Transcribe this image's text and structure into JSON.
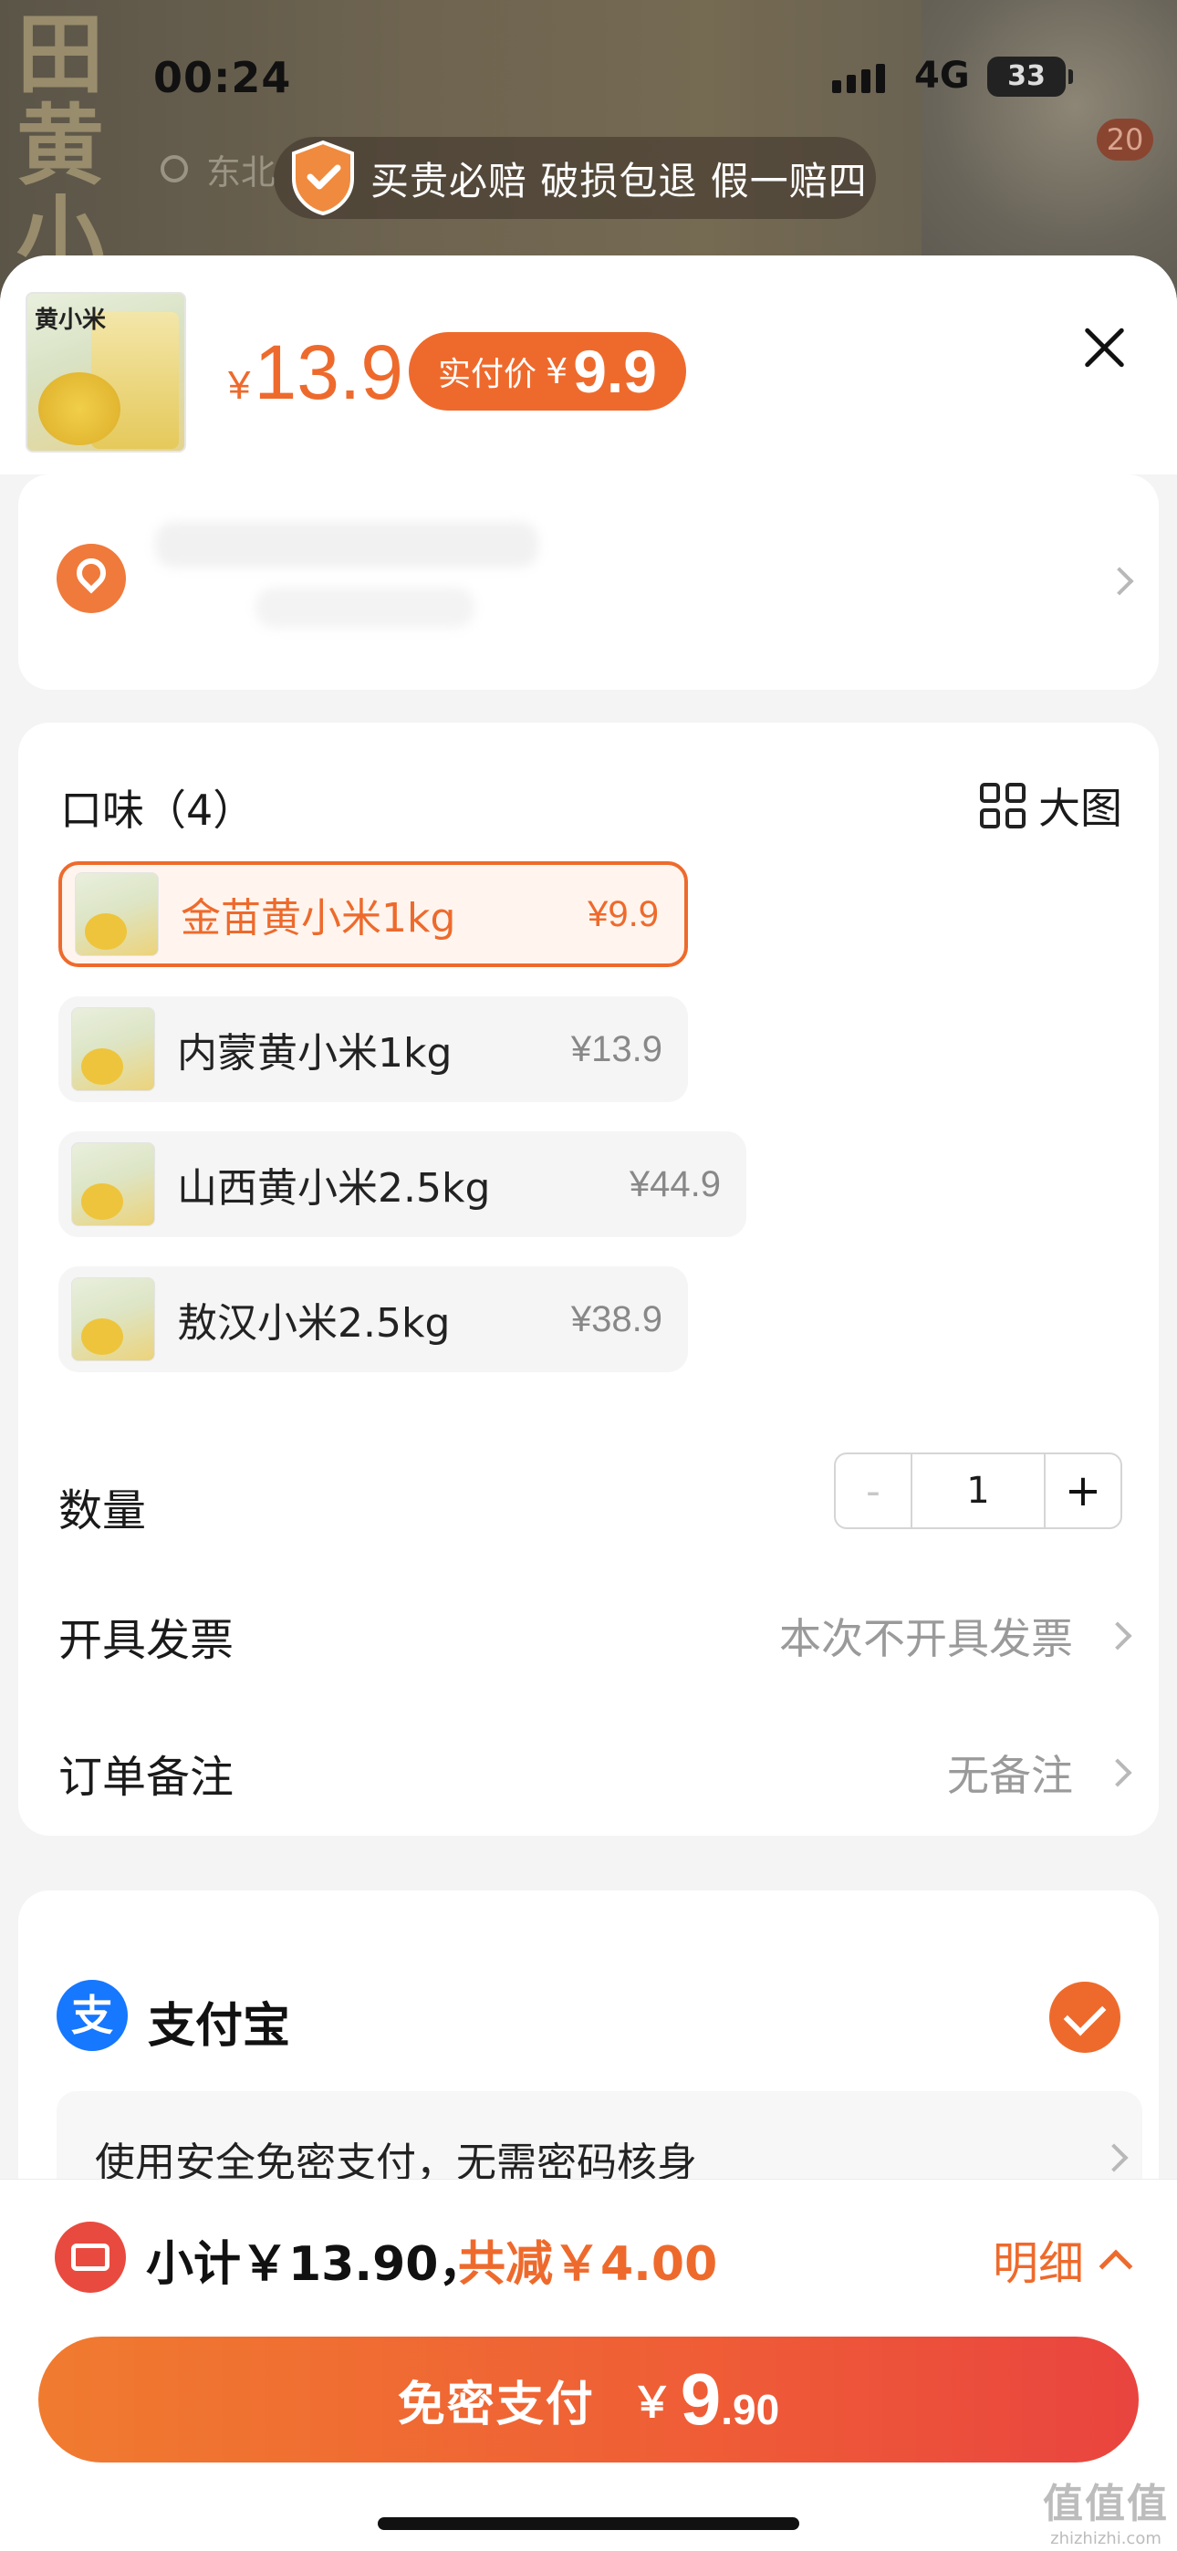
{
  "status_bar": {
    "time": "00:24",
    "network": "4G",
    "battery": "33"
  },
  "background": {
    "search_placeholder": "东北",
    "cart_count": "20",
    "art_text": "田黄小米"
  },
  "guarantee": {
    "text": "买贵必赔 破损包退 假一赔四"
  },
  "header": {
    "thumb_label": "黄小米",
    "currency": "¥",
    "price": "13.9",
    "pay_label": "实付价",
    "pay_currency": "¥",
    "pay_price": "9.9"
  },
  "spec": {
    "title": "口味（4）",
    "big_image_label": "大图",
    "options": [
      {
        "name": "金苗黄小米1kg",
        "price": "¥9.9",
        "selected": true
      },
      {
        "name": "内蒙黄小米1kg",
        "price": "¥13.9",
        "selected": false
      },
      {
        "name": "山西黄小米2.5kg",
        "price": "¥44.9",
        "selected": false
      },
      {
        "name": "敖汉小米2.5kg",
        "price": "¥38.9",
        "selected": false
      }
    ]
  },
  "quantity": {
    "label": "数量",
    "value": "1",
    "minus": "-",
    "plus": "+"
  },
  "invoice": {
    "label": "开具发票",
    "value": "本次不开具发票"
  },
  "remark": {
    "label": "订单备注",
    "value": "无备注"
  },
  "payment": {
    "method_icon": "支",
    "method": "支付宝",
    "note": "使用安全免密支付，无需密码核身"
  },
  "summary": {
    "subtotal": "小计￥13.90，",
    "discount": "共减￥4.00",
    "detail_label": "明细"
  },
  "pay_button": {
    "label": "免密支付",
    "currency": "￥",
    "amount_int": "9",
    "amount_dec": ".90"
  },
  "watermark": {
    "logo": "值值值",
    "url": "zhizhizhi.com"
  },
  "colors": {
    "accent": "#ee6a2c",
    "alipay": "#1677ff",
    "coupon": "#e94a3f"
  }
}
